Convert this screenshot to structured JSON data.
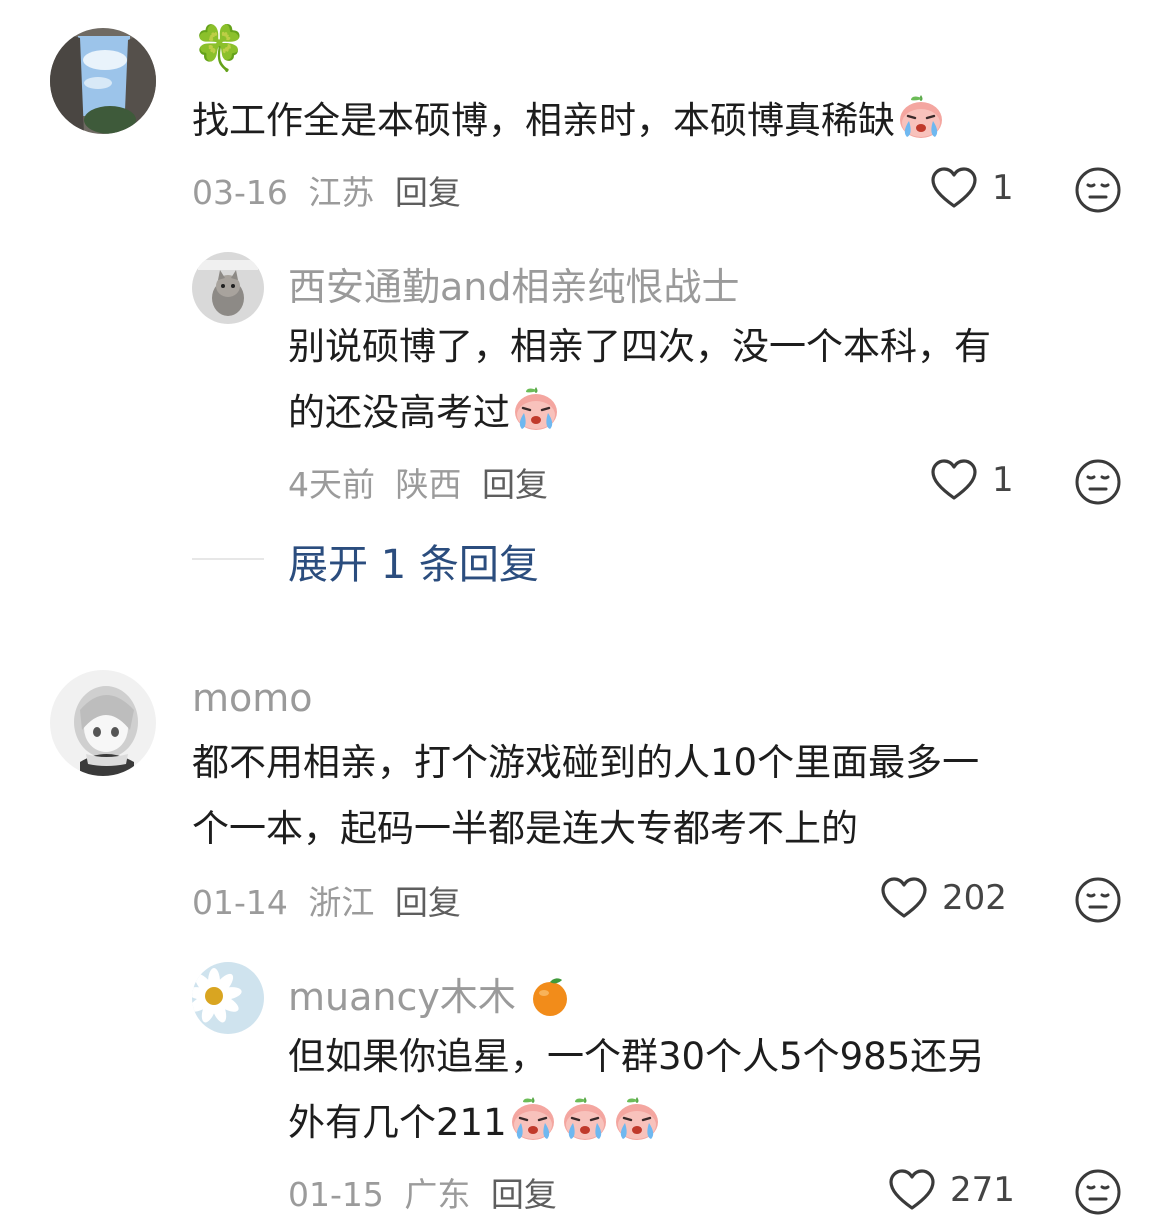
{
  "comments": [
    {
      "username": "🍀",
      "text": "找工作全是本硕博，相亲时，本硕博真稀缺",
      "date": "03-16",
      "location": "江苏",
      "reply_label": "回复",
      "likes": "1",
      "replies": [
        {
          "username": "西安通勤and相亲纯恨战士",
          "text_line1": "别说硕博了，相亲了四次，没一个本科，有",
          "text_line2": "的还没高考过",
          "date": "4天前",
          "location": "陕西",
          "reply_label": "回复",
          "likes": "1"
        }
      ],
      "expand_label": "展开 1 条回复"
    },
    {
      "username": "momo",
      "text_line1": "都不用相亲，打个游戏碰到的人10个里面最多一",
      "text_line2": "个一本，起码一半都是连大专都考不上的",
      "date": "01-14",
      "location": "浙江",
      "reply_label": "回复",
      "likes": "202",
      "replies": [
        {
          "username": "muancy木木",
          "text_line1": "但如果你追星，一个群30个人5个985还另",
          "text_line2": "外有几个211",
          "date": "01-15",
          "location": "广东",
          "reply_label": "回复",
          "likes": "271"
        }
      ]
    }
  ],
  "icons": {
    "like": "heart-outline-icon",
    "dislike": "neutral-face-icon",
    "emoji": "crying-peach-emoji"
  },
  "colors": {
    "link_blue": "#2b4d7e",
    "meta_gray": "#9b9b9b",
    "name_gray": "#9a9a9a"
  }
}
